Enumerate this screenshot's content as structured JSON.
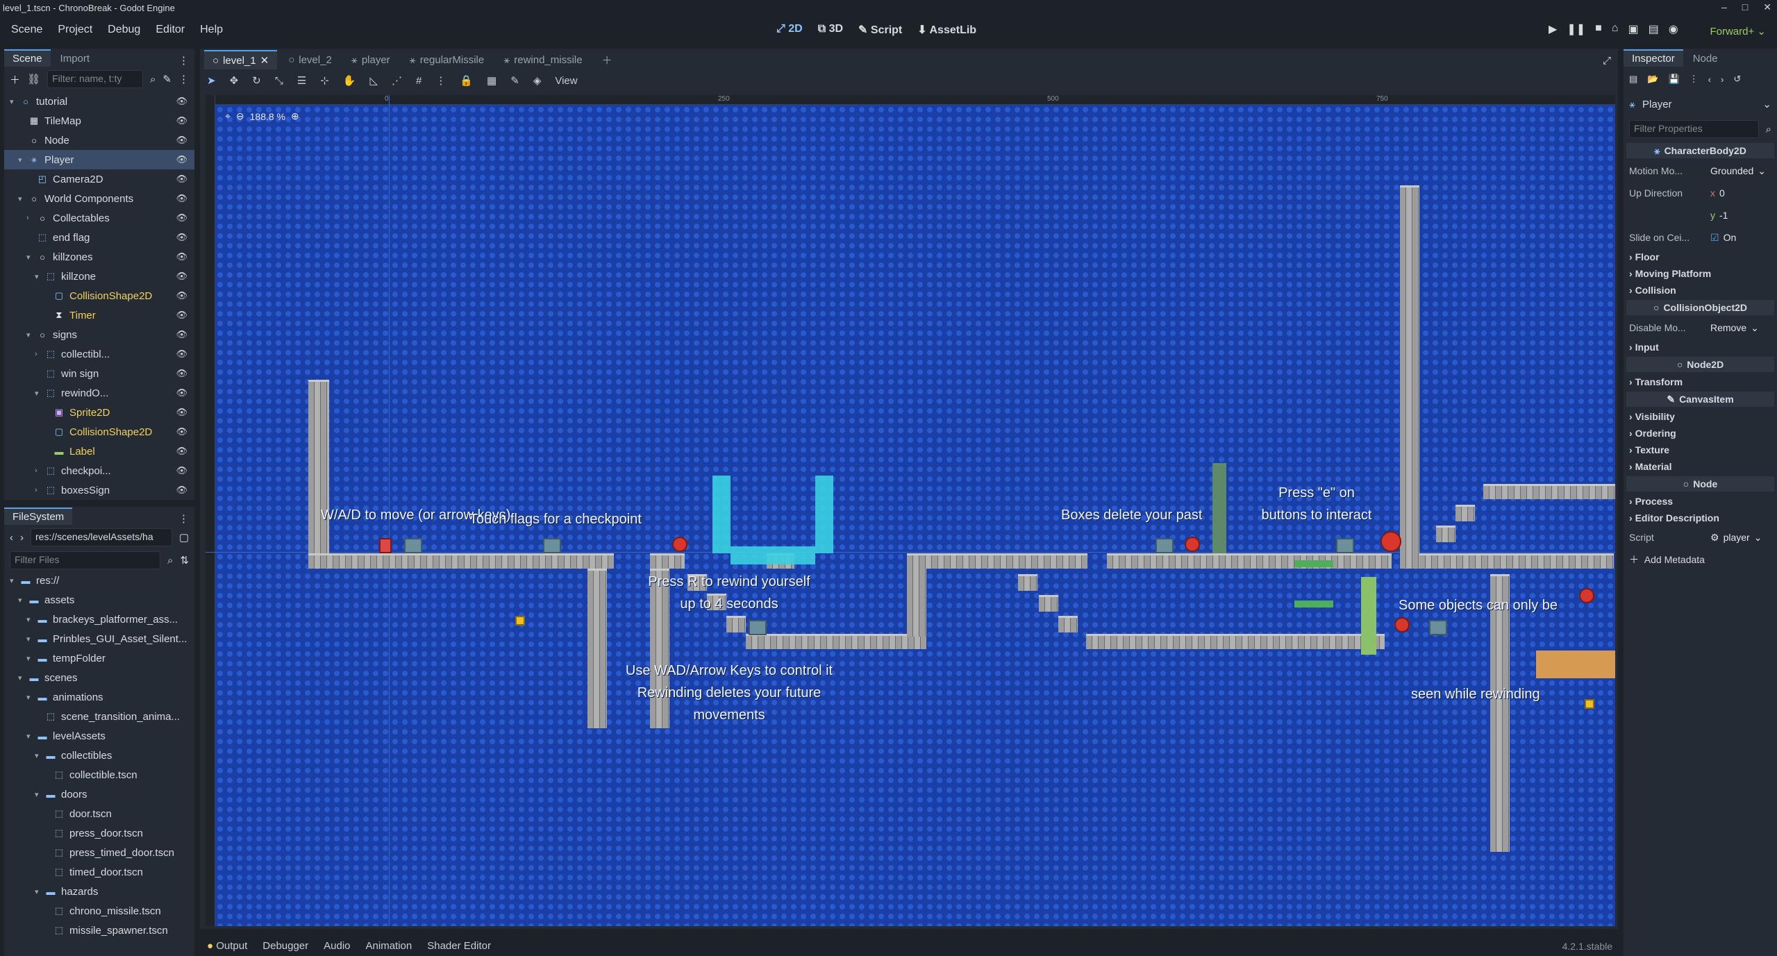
{
  "window": {
    "title": "level_1.tscn - ChronoBreak - Godot Engine"
  },
  "menu": [
    "Scene",
    "Project",
    "Debug",
    "Editor",
    "Help"
  ],
  "workspaces": [
    {
      "label": "2D",
      "active": true
    },
    {
      "label": "3D",
      "active": false
    },
    {
      "label": "Script",
      "active": false
    },
    {
      "label": "AssetLib",
      "active": false
    }
  ],
  "renderer": "Forward+",
  "scene_dock": {
    "tabs": [
      "Scene",
      "Import"
    ],
    "filter_placeholder": "Filter: name, t:ty",
    "tree": [
      {
        "label": "tutorial",
        "depth": 0,
        "icon": "node2d-icon"
      },
      {
        "label": "TileMap",
        "depth": 1,
        "icon": "tilemap-icon"
      },
      {
        "label": "Node",
        "depth": 1,
        "icon": "node-icon"
      },
      {
        "label": "Player",
        "depth": 1,
        "icon": "characterbody-icon",
        "selected": true
      },
      {
        "label": "Camera2D",
        "depth": 2,
        "icon": "camera-icon"
      },
      {
        "label": "World Components",
        "depth": 1,
        "icon": "node-icon"
      },
      {
        "label": "Collectables",
        "depth": 2,
        "icon": "node-icon"
      },
      {
        "label": "end flag",
        "depth": 2,
        "icon": "area-icon"
      },
      {
        "label": "killzones",
        "depth": 2,
        "icon": "node-icon"
      },
      {
        "label": "killzone",
        "depth": 3,
        "icon": "area-icon"
      },
      {
        "label": "CollisionShape2D",
        "depth": 4,
        "icon": "shape-icon",
        "yellow": true
      },
      {
        "label": "Timer",
        "depth": 4,
        "icon": "timer-icon",
        "yellow": true
      },
      {
        "label": "signs",
        "depth": 2,
        "icon": "node-icon"
      },
      {
        "label": "collectibl...",
        "depth": 3,
        "icon": "area-icon"
      },
      {
        "label": "win sign",
        "depth": 3,
        "icon": "area-icon"
      },
      {
        "label": "rewindO...",
        "depth": 3,
        "icon": "area-icon"
      },
      {
        "label": "Sprite2D",
        "depth": 4,
        "icon": "sprite-icon",
        "yellow": true
      },
      {
        "label": "CollisionShape2D",
        "depth": 4,
        "icon": "shape-icon",
        "yellow": true
      },
      {
        "label": "Label",
        "depth": 4,
        "icon": "label-icon",
        "yellow": true
      },
      {
        "label": "checkpoi...",
        "depth": 3,
        "icon": "area-icon"
      },
      {
        "label": "boxesSign",
        "depth": 3,
        "icon": "area-icon"
      }
    ]
  },
  "filesystem": {
    "title": "FileSystem",
    "path": "res://scenes/levelAssets/ha",
    "filter_placeholder": "Filter Files",
    "tree": [
      {
        "label": "res://",
        "depth": 0,
        "folder": true
      },
      {
        "label": "assets",
        "depth": 1,
        "folder": true
      },
      {
        "label": "brackeys_platformer_ass...",
        "depth": 2,
        "folder": true
      },
      {
        "label": "Prinbles_GUI_Asset_Silent...",
        "depth": 2,
        "folder": true
      },
      {
        "label": "tempFolder",
        "depth": 2,
        "folder": true
      },
      {
        "label": "scenes",
        "depth": 1,
        "folder": true
      },
      {
        "label": "animations",
        "depth": 2,
        "folder": true
      },
      {
        "label": "scene_transition_anima...",
        "depth": 3,
        "folder": false
      },
      {
        "label": "levelAssets",
        "depth": 2,
        "folder": true
      },
      {
        "label": "collectibles",
        "depth": 3,
        "folder": true
      },
      {
        "label": "collectible.tscn",
        "depth": 4,
        "folder": false
      },
      {
        "label": "doors",
        "depth": 3,
        "folder": true
      },
      {
        "label": "door.tscn",
        "depth": 4,
        "folder": false
      },
      {
        "label": "press_door.tscn",
        "depth": 4,
        "folder": false
      },
      {
        "label": "press_timed_door.tscn",
        "depth": 4,
        "folder": false
      },
      {
        "label": "timed_door.tscn",
        "depth": 4,
        "folder": false
      },
      {
        "label": "hazards",
        "depth": 3,
        "folder": true
      },
      {
        "label": "chrono_missile.tscn",
        "depth": 4,
        "folder": false
      },
      {
        "label": "missile_spawner.tscn",
        "depth": 4,
        "folder": false
      }
    ]
  },
  "editor_tabs": [
    {
      "label": "level_1",
      "active": true
    },
    {
      "label": "level_2",
      "active": false
    },
    {
      "label": "player",
      "active": false
    },
    {
      "label": "regularMissile",
      "active": false
    },
    {
      "label": "rewind_missile",
      "active": false
    }
  ],
  "viewport": {
    "view_label": "View",
    "zoom": "188.8 %",
    "ruler_marks": [
      "0",
      "250",
      "500",
      "750"
    ],
    "texts": {
      "move": "W/A/D to move (or arrow keys)",
      "flags": "Touch flags for a checkpoint",
      "rewind1": "Press R to rewind yourself",
      "rewind2": "up to 4 seconds",
      "control1": "Use WAD/Arrow Keys to control it",
      "control2": "Rewinding deletes your future",
      "control3": "movements",
      "boxes": "Boxes delete your past",
      "press1": "Press \"e\" on",
      "press2": "buttons to interact",
      "objects1": "Some objects can only be",
      "objects2": "seen while rewinding"
    }
  },
  "bottom_panel": {
    "tabs": [
      "Output",
      "Debugger",
      "Audio",
      "Animation",
      "Shader Editor"
    ],
    "version": "4.2.1.stable"
  },
  "inspector": {
    "tabs": [
      "Inspector",
      "Node"
    ],
    "object": "Player",
    "filter_placeholder": "Filter Properties",
    "class_header": "CharacterBody2D",
    "motion_mode": {
      "label": "Motion Mo...",
      "value": "Grounded"
    },
    "up_direction": {
      "label": "Up Direction",
      "x": "0",
      "y": "-1"
    },
    "slide_on_ceiling": {
      "label": "Slide on Cei...",
      "value": "On"
    },
    "sections1": [
      "Floor",
      "Moving Platform",
      "Collision"
    ],
    "class2": "CollisionObject2D",
    "disable_mode": {
      "label": "Disable Mo...",
      "value": "Remove"
    },
    "sections2": [
      "Input"
    ],
    "class3": "Node2D",
    "sections3": [
      "Transform"
    ],
    "class4": "CanvasItem",
    "sections4": [
      "Visibility",
      "Ordering",
      "Texture",
      "Material"
    ],
    "class5": "Node",
    "sections5": [
      "Process",
      "Editor Description"
    ],
    "script": {
      "label": "Script",
      "value": "player"
    },
    "add_metadata": "Add Metadata"
  },
  "colors": {
    "accent": "#5aa0e8",
    "selection": "#3a4c67",
    "renderer": "#9bce62",
    "canvas": "#1a3fa6"
  }
}
